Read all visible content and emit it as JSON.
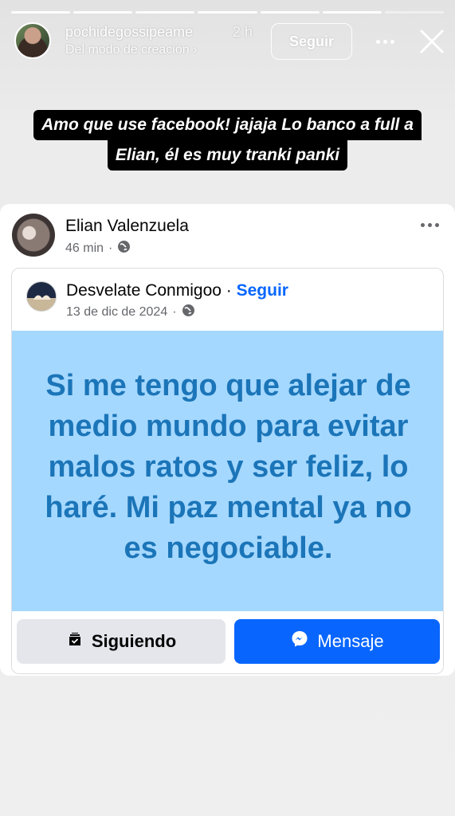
{
  "story": {
    "progress_segments": 7,
    "progress_current": 6,
    "username": "pochidegossipeame",
    "time": "2 h",
    "subtitle": "Del modo de creación ›",
    "follow_label": "Seguir",
    "caption_line1": "Amo que use facebook! jajaja Lo banco a full a",
    "caption_line2": "Elian, él es muy tranki panki"
  },
  "post": {
    "author": "Elian Valenzuela",
    "time": "46 min",
    "separator": "·",
    "shared": {
      "page_name": "Desvelate Conmigoo",
      "dot": "·",
      "follow_label": "Seguir",
      "date": "13 de dic de 2024",
      "quote": "Si me tengo que alejar de medio mundo para evitar malos ratos y ser feliz, lo haré. Mi paz mental ya no es negociable.",
      "following_label": "Siguiendo",
      "message_label": "Mensaje"
    }
  },
  "colors": {
    "fb_blue": "#0866ff",
    "quote_bg": "#a5d8ff",
    "quote_text": "#1b75b8"
  },
  "icons": [
    "more-icon",
    "close-icon",
    "globe-icon",
    "following-icon",
    "messenger-icon"
  ]
}
